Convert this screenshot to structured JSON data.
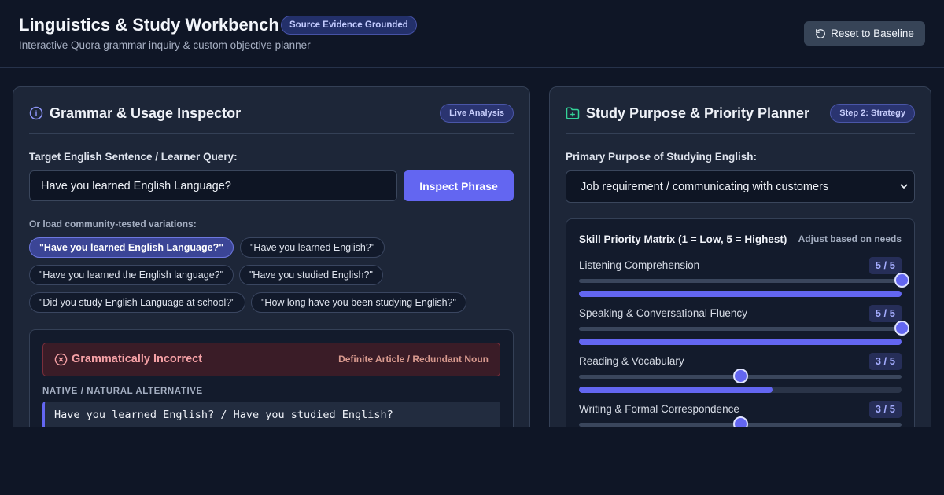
{
  "header": {
    "title": "Linguistics & Study Workbench",
    "badge": "Source Evidence Grounded",
    "subtitle": "Interactive Quora grammar inquiry & custom objective planner",
    "reset_label": "Reset to Baseline",
    "reset_icon": "rotate-ccw-icon"
  },
  "inspector": {
    "title": "Grammar & Usage Inspector",
    "icon": "info-circle-icon",
    "status_pill": "Live Analysis",
    "query_label": "Target English Sentence / Learner Query:",
    "query_value": "Have you learned English Language?",
    "inspect_label": "Inspect Phrase",
    "variations_label": "Or load community-tested variations:",
    "variations": [
      "\"Have you learned English Language?\"",
      "\"Have you learned English?\"",
      "\"Have you learned the English language?\"",
      "\"Have you studied English?\"",
      "\"Did you study English Language at school?\"",
      "\"How long have you been studying English?\""
    ],
    "active_variation": 0,
    "result": {
      "verdict": "Grammatically Incorrect",
      "verdict_icon": "x-circle-icon",
      "issue_tag": "Definite Article / Redundant Noun",
      "alt_label": "NATIVE / NATURAL ALTERNATIVE",
      "alt_text": "Have you learned English? / Have you studied English?"
    },
    "colors": {
      "accent": "#6366f1",
      "error": "#f6a1a6"
    }
  },
  "planner": {
    "title": "Study Purpose & Priority Planner",
    "icon": "folder-plus-icon",
    "step_pill": "Step 2: Strategy",
    "purpose_label": "Primary Purpose of Studying English:",
    "purpose_value": "Job requirement / communicating with customers",
    "matrix_title": "Skill Priority Matrix (1 = Low, 5 = Highest)",
    "matrix_hint": "Adjust based on needs",
    "skills": [
      {
        "name": "Listening Comprehension",
        "score": "5 / 5",
        "level": 5
      },
      {
        "name": "Speaking & Conversational Fluency",
        "score": "5 / 5",
        "level": 5
      },
      {
        "name": "Reading & Vocabulary",
        "score": "3 / 5",
        "level": 3
      },
      {
        "name": "Writing & Formal Correspondence",
        "score": "3 / 5",
        "level": 3
      }
    ]
  }
}
